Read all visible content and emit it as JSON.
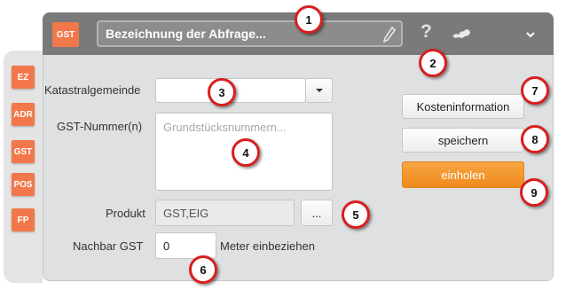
{
  "header": {
    "badge": "GST",
    "title_placeholder": "Bezeichnung der Abfrage...",
    "help": "?"
  },
  "sidebar": {
    "items": [
      {
        "label": "EZ"
      },
      {
        "label": "ADR"
      },
      {
        "label": "GST"
      },
      {
        "label": "POS"
      },
      {
        "label": "FP"
      }
    ]
  },
  "form": {
    "katastralgemeinde_label": "Katastralgemeinde",
    "katastralgemeinde_value": "",
    "gst_nummer_label": "GST-Nummer(n)",
    "gst_nummer_placeholder": "Grundstücksnummern...",
    "produkt_label": "Produkt",
    "produkt_value": "GST,EIG",
    "produkt_button": "...",
    "nachbar_label": "Nachbar GST",
    "nachbar_value": "0",
    "nachbar_suffix": "Meter einbeziehen"
  },
  "actions": {
    "kosten": "Kosteninformation",
    "speichern": "speichern",
    "einholen": "einholen"
  },
  "markers": [
    "1",
    "2",
    "3",
    "4",
    "5",
    "6",
    "7",
    "8",
    "9"
  ],
  "colors": {
    "accent_orange": "#f2784b",
    "header_gray": "#7a7a7a",
    "button_orange": "#f0901f",
    "marker_red": "#d81f1f"
  }
}
